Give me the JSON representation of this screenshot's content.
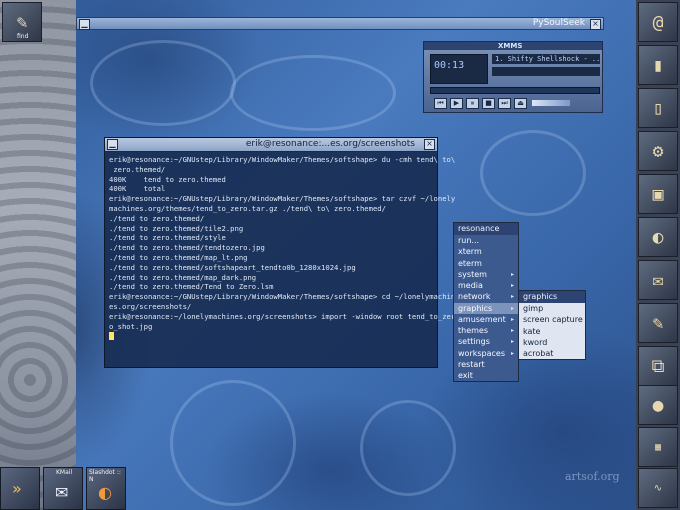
{
  "clip": {
    "label": "find"
  },
  "top_window": {
    "title": "PySoulSeek"
  },
  "xmms": {
    "title": "XMMS",
    "timer": "00:13",
    "song": "1. Shifty Shellshock - ..."
  },
  "terminal": {
    "title": "erik@resonance:...es.org/screenshots",
    "lines": [
      "erik@resonance:~/GNUstep/Library/WindowMaker/Themes/softshape> du -cmh tend\\ to\\",
      " zero.themed/",
      "400K    tend to zero.themed",
      "400K    total",
      "erik@resonance:~/GNUstep/Library/WindowMaker/Themes/softshape> tar czvf ~/lonely",
      "machines.org/themes/tend_to_zero.tar.gz ./tend\\ to\\ zero.themed/",
      "./tend to zero.themed/",
      "./tend to zero.themed/tile2.png",
      "./tend to zero.themed/style",
      "./tend to zero.themed/tendtozero.jpg",
      "./tend to zero.themed/map_lt.png",
      "./tend to zero.themed/softshapeart_tendto0b_1280x1024.jpg",
      "./tend to zero.themed/map_dark.png",
      "./tend to zero.themed/Tend to Zero.lsm",
      "erik@resonance:~/GNUstep/Library/WindowMaker/Themes/softshape> cd ~/lonelymachin",
      "es.org/screenshots/",
      "erik@resonance:~/lonelymachines.org/screenshots> import -window root tend_to_zer",
      "o_shot.jpg"
    ]
  },
  "root_menu": {
    "title": "resonance",
    "items": [
      "run...",
      "xterm",
      "eterm",
      "system",
      "media",
      "network",
      "graphics",
      "amusement",
      "themes",
      "settings",
      "workspaces",
      "restart",
      "exit"
    ]
  },
  "graphics_menu": {
    "title": "graphics",
    "items": [
      "gimp",
      "screen capture",
      "kate",
      "kword",
      "acrobat"
    ]
  },
  "bottom": {
    "kmail_label": "KMail",
    "slashdot_label": "Slashdot :: N"
  },
  "watermark": "artsof.org"
}
